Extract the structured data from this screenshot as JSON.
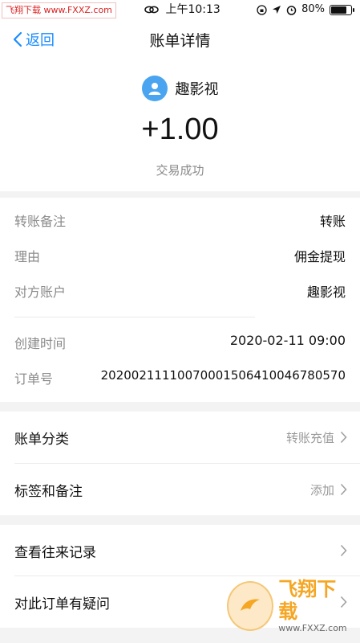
{
  "status_bar": {
    "watermark_left": "飞翔下载",
    "watermark_url": "www.FXXZ.com",
    "time": "上午10:13",
    "battery": "80%"
  },
  "nav": {
    "back_label": "返回",
    "title": "账单详情"
  },
  "header": {
    "payee": "趣影视",
    "amount": "+1.00",
    "status": "交易成功"
  },
  "details": [
    {
      "label": "转账备注",
      "value": "转账"
    },
    {
      "label": "理由",
      "value": "佣金提现"
    },
    {
      "label": "对方账户",
      "value": "趣影视"
    },
    {
      "label": "创建时间",
      "value": "2020-02-11 09:00"
    },
    {
      "label": "订单号",
      "value": "20200211110070001506410046780570"
    }
  ],
  "menu": [
    {
      "label": "账单分类",
      "value": "转账充值"
    },
    {
      "label": "标签和备注",
      "value": "添加"
    },
    {
      "label": "查看往来记录",
      "value": ""
    },
    {
      "label": "对此订单有疑问",
      "value": ""
    }
  ],
  "watermark_bottom": {
    "brand": "飞翔下载",
    "url": "www.FXXZ.com"
  },
  "colors": {
    "accent": "#1a8cff",
    "avatar": "#4aa4ef",
    "muted": "#8a8a8a"
  }
}
